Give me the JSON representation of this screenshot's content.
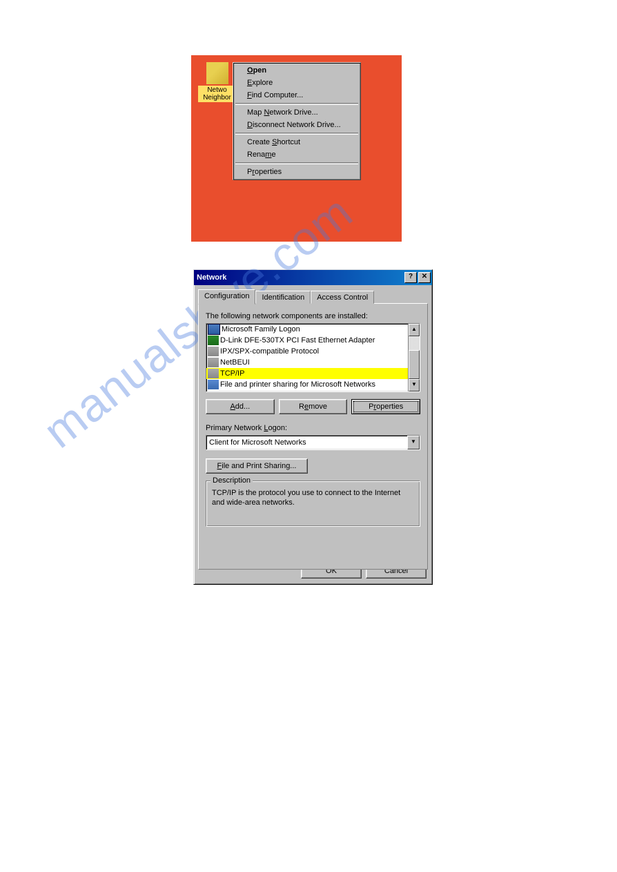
{
  "desktop": {
    "icon_label_1": "Netwo",
    "icon_label_2": "Neighbor"
  },
  "context_menu": {
    "open": "Open",
    "explore": "Explore",
    "find_computer": "Find Computer...",
    "map_drive": "Map Network Drive...",
    "disconnect_drive": "Disconnect Network Drive...",
    "create_shortcut": "Create Shortcut",
    "rename": "Rename",
    "properties": "Properties"
  },
  "dialog": {
    "title": "Network",
    "tabs": {
      "configuration": "Configuration",
      "identification": "Identification",
      "access_control": "Access Control"
    },
    "list_label": "The following network components are installed:",
    "components": [
      "Microsoft Family Logon",
      "D-Link DFE-530TX PCI Fast Ethernet Adapter",
      "IPX/SPX-compatible Protocol",
      "NetBEUI",
      "TCP/IP",
      "File and printer sharing for Microsoft Networks"
    ],
    "buttons": {
      "add": "Add...",
      "remove": "Remove",
      "properties": "Properties"
    },
    "primary_logon_label": "Primary Network Logon:",
    "primary_logon_value": "Client for Microsoft Networks",
    "file_print_sharing": "File and Print Sharing...",
    "description_label": "Description",
    "description_text": "TCP/IP is the protocol you use to connect to the Internet and wide-area networks.",
    "ok": "OK",
    "cancel": "Cancel"
  },
  "watermark": "manualshive.com"
}
